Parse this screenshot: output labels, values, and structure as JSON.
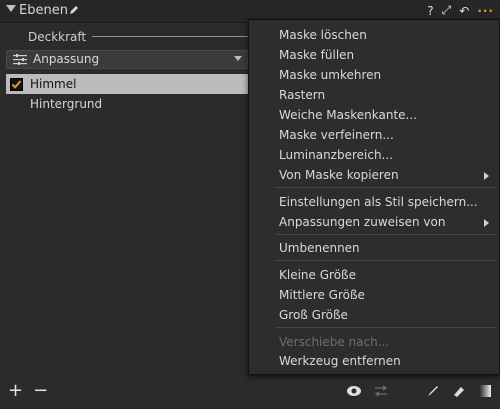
{
  "panel": {
    "title": "Ebenen",
    "opacity_label": "Deckkraft",
    "adjustment_label": "Anpassung",
    "layers": [
      {
        "name": "Himmel",
        "checked": true,
        "selected": true
      },
      {
        "name": "Hintergrund",
        "checked": false,
        "selected": false
      }
    ],
    "header_icons": [
      "help-icon",
      "expand-icon",
      "reset-icon",
      "more-icon"
    ],
    "accent_color": "#e39a2c"
  },
  "menu": {
    "items": [
      {
        "label": "Maske löschen",
        "enabled": true
      },
      {
        "label": "Maske füllen",
        "enabled": true
      },
      {
        "label": "Maske umkehren",
        "enabled": true
      },
      {
        "label": "Rastern",
        "enabled": true
      },
      {
        "label": "Weiche Maskenkante...",
        "enabled": true
      },
      {
        "label": "Maske verfeinern...",
        "enabled": true
      },
      {
        "label": "Luminanzbereich...",
        "enabled": true
      },
      {
        "label": "Von Maske kopieren",
        "enabled": true,
        "submenu": true
      },
      {
        "label": "Einstellungen als Stil speichern...",
        "enabled": true
      },
      {
        "label": "Anpassungen zuweisen von",
        "enabled": true,
        "submenu": true
      },
      {
        "label": "Umbenennen",
        "enabled": true
      },
      {
        "label": "Kleine Größe",
        "enabled": true
      },
      {
        "label": "Mittlere Größe",
        "enabled": true
      },
      {
        "label": "Groß Größe",
        "enabled": true
      },
      {
        "label": "Verschiebe nach...",
        "enabled": false
      },
      {
        "label": "Werkzeug entfernen",
        "enabled": true
      }
    ]
  }
}
